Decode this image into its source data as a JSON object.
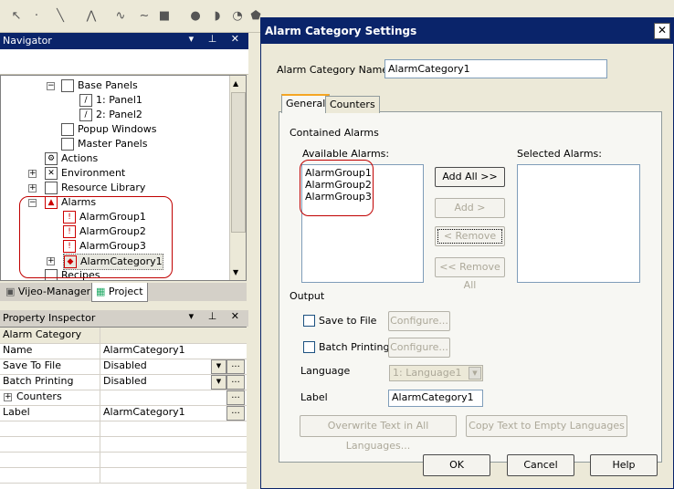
{
  "navigator": {
    "title": "Navigator",
    "tree": [
      {
        "label": "Base Panels",
        "icon": "panels-icon"
      },
      {
        "label": "1: Panel1",
        "icon": "panel-icon"
      },
      {
        "label": "2: Panel2",
        "icon": "panel-icon"
      },
      {
        "label": "Popup Windows",
        "icon": "popup-window-icon"
      },
      {
        "label": "Master Panels",
        "icon": "master-panel-icon"
      },
      {
        "label": "Actions",
        "icon": "actions-icon"
      },
      {
        "label": "Environment",
        "icon": "environment-icon"
      },
      {
        "label": "Resource Library",
        "icon": "resource-library-icon"
      },
      {
        "label": "Alarms",
        "icon": "alarms-icon"
      },
      {
        "label": "AlarmGroup1",
        "icon": "alarm-group-icon"
      },
      {
        "label": "AlarmGroup2",
        "icon": "alarm-group-icon"
      },
      {
        "label": "AlarmGroup3",
        "icon": "alarm-group-icon"
      },
      {
        "label": "AlarmCategory1",
        "icon": "alarm-category-icon"
      },
      {
        "label": "Recipes",
        "icon": "recipes-icon"
      }
    ],
    "tabs": [
      "Vijeo-Manager",
      "Project"
    ]
  },
  "inspector": {
    "title": "Property Inspector",
    "header": "Alarm Category",
    "rows": [
      {
        "name": "Name",
        "value": "AlarmCategory1"
      },
      {
        "name": "Save To File",
        "value": "Disabled"
      },
      {
        "name": "Batch Printing",
        "value": "Disabled"
      },
      {
        "name": "Counters",
        "value": ""
      },
      {
        "name": "Label",
        "value": "AlarmCategory1"
      }
    ],
    "expander_symbol": "+",
    "ellipsis": "..."
  },
  "dialog": {
    "title": "Alarm Category Settings",
    "close": "✕",
    "name_label": "Alarm Category Name:",
    "name_value": "AlarmCategory1",
    "tabs": [
      "General",
      "Counters"
    ],
    "contained_alarms": "Contained Alarms",
    "available_label": "Available Alarms:",
    "available_items": [
      "AlarmGroup1",
      "AlarmGroup2",
      "AlarmGroup3"
    ],
    "selected_label": "Selected Alarms:",
    "buttons": {
      "add_all": "Add All >>",
      "add": "Add >",
      "remove": "< Remove",
      "remove_all": "<< Remove All",
      "configure": "Configure...",
      "overwrite": "Overwrite Text in All Languages...",
      "copy_text": "Copy Text to Empty Languages",
      "ok": "OK",
      "cancel": "Cancel",
      "help": "Help"
    },
    "output_label": "Output",
    "save_to_file": "Save to File",
    "batch_printing": "Batch Printing",
    "language_label": "Language",
    "language_value": "1: Language1",
    "label_label": "Label",
    "label_value": "AlarmCategory1"
  },
  "colors": {
    "titlebar": "#0a246a",
    "annotation": "#c00000",
    "tab_highlight": "#f5a623"
  }
}
